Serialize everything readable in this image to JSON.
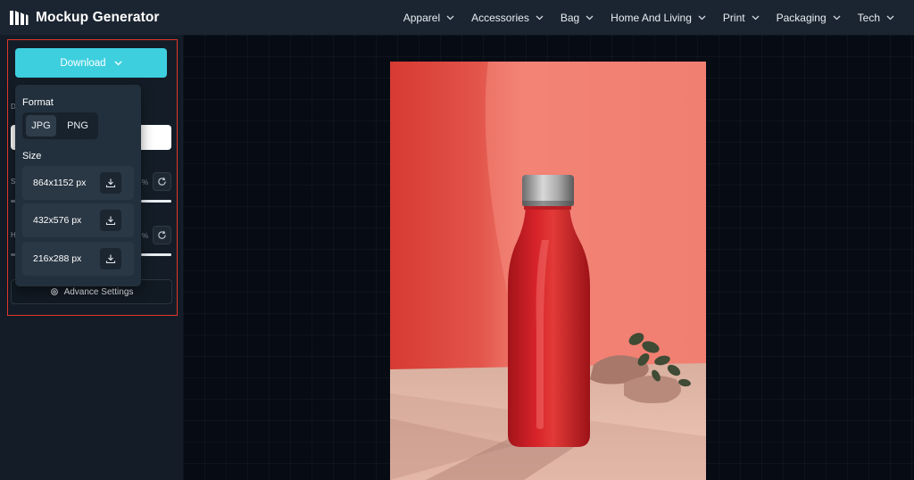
{
  "app": {
    "name": "Mockup Generator",
    "logo_icon": "mockup-generator-logo-icon"
  },
  "nav": {
    "items": [
      {
        "label": "Apparel"
      },
      {
        "label": "Accessories"
      },
      {
        "label": "Bag"
      },
      {
        "label": "Home And Living"
      },
      {
        "label": "Print"
      },
      {
        "label": "Packaging"
      },
      {
        "label": "Tech"
      }
    ],
    "dropdown_icon": "chevron-down-icon"
  },
  "sidebar": {
    "download_label": "Download",
    "advance_settings_label": "Advance Settings",
    "advance_settings_icon": "gear-icon",
    "partial_labels": [
      "D",
      "S",
      "H"
    ],
    "reset_icon": "refresh-icon"
  },
  "download_menu": {
    "format_label": "Format",
    "formats": [
      "JPG",
      "PNG"
    ],
    "selected_format": "JPG",
    "size_label": "Size",
    "sizes": [
      {
        "label": "864x1152 px"
      },
      {
        "label": "432x576 px"
      },
      {
        "label": "216x288 px"
      }
    ],
    "size_download_icon": "download-icon"
  },
  "preview": {
    "subject": "red-water-bottle-mockup"
  },
  "colors": {
    "topbar_bg": "#1b2531",
    "sidebar_bg": "#141d27",
    "canvas_bg": "#060b14",
    "accent": "#3ecfdf",
    "highlight_frame": "#e0362b",
    "bottle_red": "#d7242a",
    "wall_coral": "#ea6a5e"
  }
}
